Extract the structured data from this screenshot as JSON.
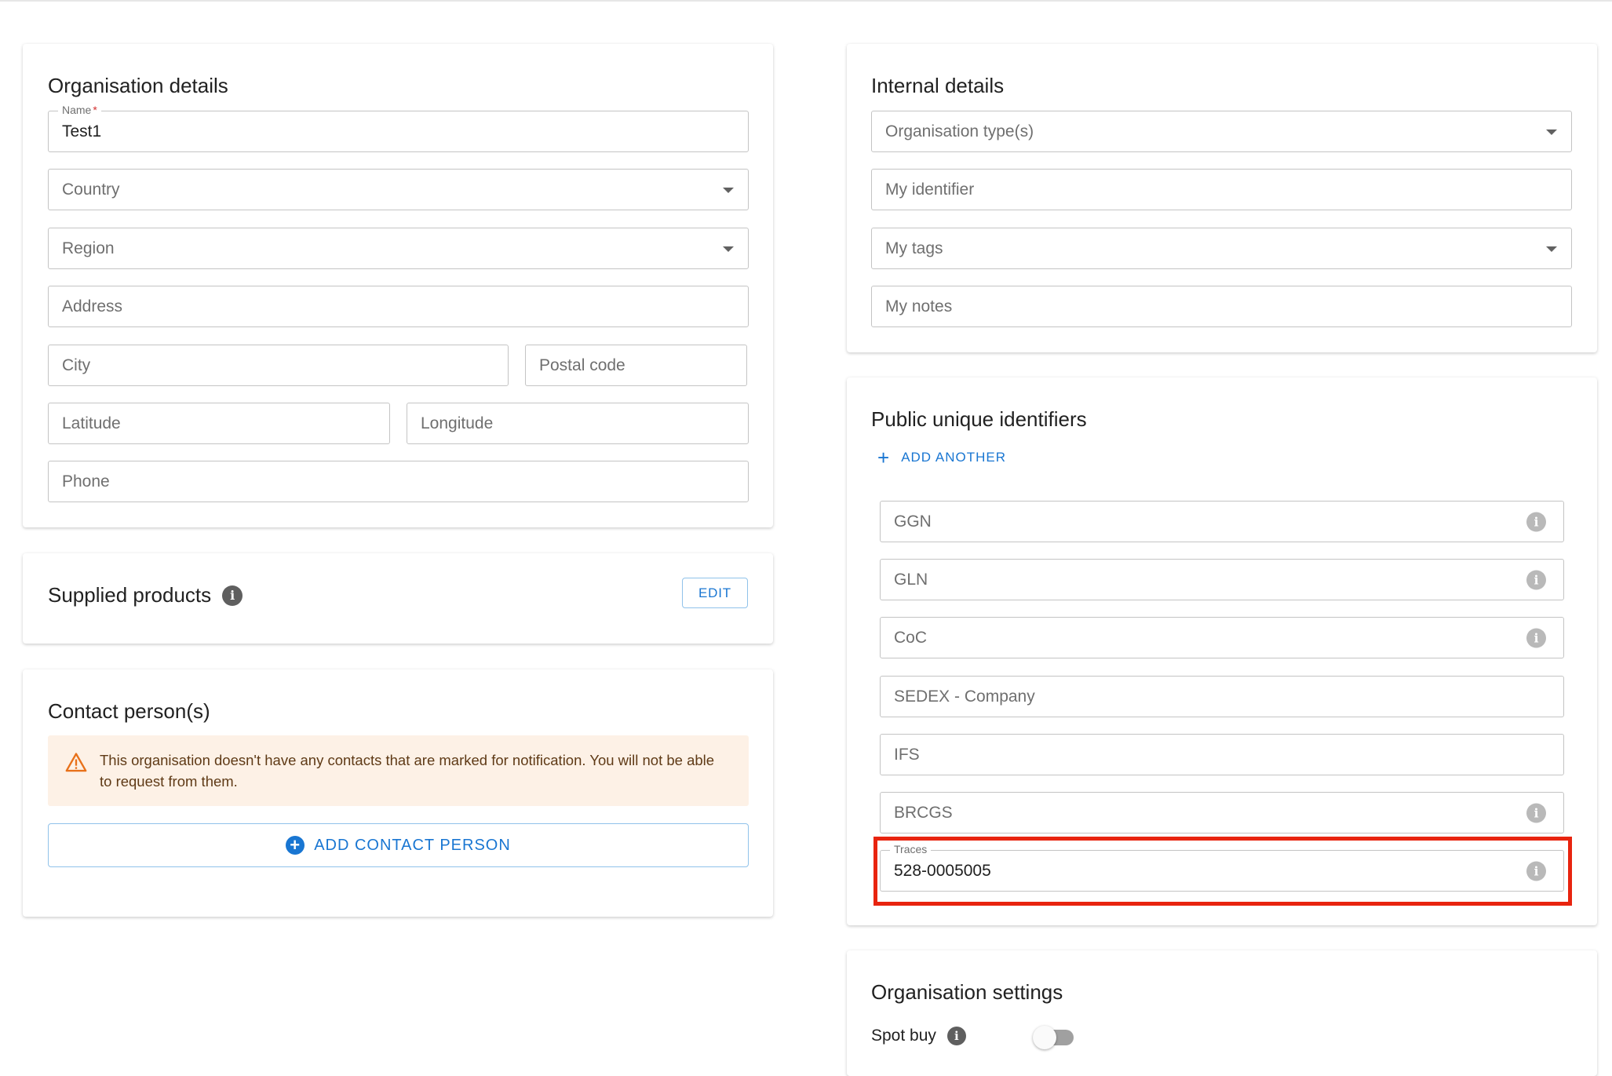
{
  "organisation_details": {
    "title": "Organisation details",
    "name_label": "Name",
    "name_required": "*",
    "name_value": "Test1",
    "country_placeholder": "Country",
    "region_placeholder": "Region",
    "address_placeholder": "Address",
    "city_placeholder": "City",
    "postal_code_placeholder": "Postal code",
    "latitude_placeholder": "Latitude",
    "longitude_placeholder": "Longitude",
    "phone_placeholder": "Phone"
  },
  "supplied_products": {
    "title": "Supplied products",
    "info_icon": "info-icon",
    "edit_label": "EDIT"
  },
  "contact_persons": {
    "title": "Contact person(s)",
    "warning_icon": "warning-triangle-icon",
    "warning_text": "This organisation doesn't have any contacts that are marked for notification. You will not be able to request from them.",
    "add_label": "ADD CONTACT PERSON"
  },
  "internal_details": {
    "title": "Internal details",
    "org_type_placeholder": "Organisation type(s)",
    "identifier_placeholder": "My identifier",
    "tags_placeholder": "My tags",
    "notes_placeholder": "My notes"
  },
  "public_identifiers": {
    "title": "Public unique identifiers",
    "add_another_label": "ADD ANOTHER",
    "fields": {
      "ggn": "GGN",
      "gln": "GLN",
      "coc": "CoC",
      "sedex": "SEDEX - Company",
      "ifs": "IFS",
      "brcgs": "BRCGS",
      "traces_label": "Traces",
      "traces_value": "528-0005005"
    }
  },
  "organisation_settings": {
    "title": "Organisation settings",
    "spot_buy_label": "Spot buy",
    "spot_buy_enabled": false
  },
  "colors": {
    "accent": "#1976d2",
    "warning_bg": "#fdf1e6",
    "warning_icon": "#e8711a",
    "highlight_border": "#e8240f"
  }
}
